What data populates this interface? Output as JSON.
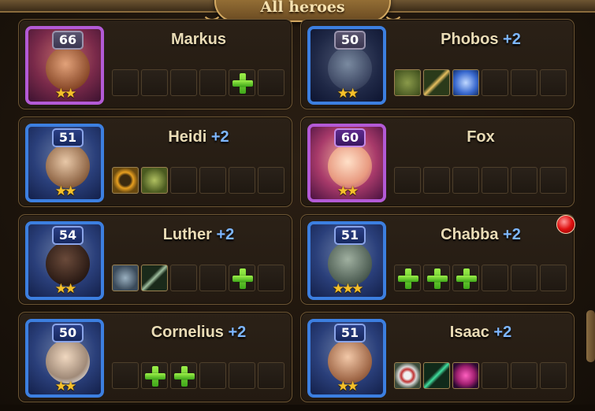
{
  "header": {
    "title": "All heroes"
  },
  "heroes": [
    {
      "name": "Markus",
      "bonus": "",
      "level": "66",
      "stars": 2,
      "frame": "purple",
      "slots": [
        "empty",
        "empty",
        "empty",
        "empty",
        "plus",
        "empty"
      ]
    },
    {
      "name": "Phobos",
      "bonus": "+2",
      "level": "50",
      "stars": 2,
      "frame": "blue",
      "slots": [
        "item-warrior-icon",
        "item-sword-icon",
        "item-potion-icon",
        "empty",
        "empty",
        "empty"
      ]
    },
    {
      "name": "Heidi",
      "bonus": "+2",
      "level": "51",
      "stars": 2,
      "frame": "blue",
      "slots": [
        "item-ring-icon",
        "item-plant-icon",
        "empty",
        "empty",
        "empty",
        "empty"
      ]
    },
    {
      "name": "Fox",
      "bonus": "",
      "level": "60",
      "stars": 2,
      "frame": "purple",
      "slots": [
        "empty",
        "empty",
        "empty",
        "empty",
        "empty",
        "empty"
      ]
    },
    {
      "name": "Luther",
      "bonus": "+2",
      "level": "54",
      "stars": 2,
      "frame": "blue",
      "slots": [
        "item-armor-icon",
        "item-blade-icon",
        "empty",
        "empty",
        "plus",
        "empty"
      ]
    },
    {
      "name": "Chabba",
      "bonus": "+2",
      "level": "51",
      "stars": 3,
      "frame": "blue",
      "slots": [
        "plus",
        "plus",
        "plus",
        "empty",
        "empty",
        "empty"
      ]
    },
    {
      "name": "Cornelius",
      "bonus": "+2",
      "level": "50",
      "stars": 2,
      "frame": "blue",
      "slots": [
        "empty",
        "plus",
        "plus",
        "empty",
        "empty",
        "empty"
      ]
    },
    {
      "name": "Isaac",
      "bonus": "+2",
      "level": "51",
      "stars": 2,
      "frame": "blue",
      "slots": [
        "item-shield-icon",
        "item-staff-icon",
        "item-orb-icon",
        "empty",
        "empty",
        "empty"
      ]
    }
  ],
  "colors": {
    "bonus": "#7db6ff",
    "name": "#eadcb6",
    "star": "#f5c02a",
    "purple_frame": "#b35ad6",
    "blue_frame": "#3c7fe0"
  }
}
